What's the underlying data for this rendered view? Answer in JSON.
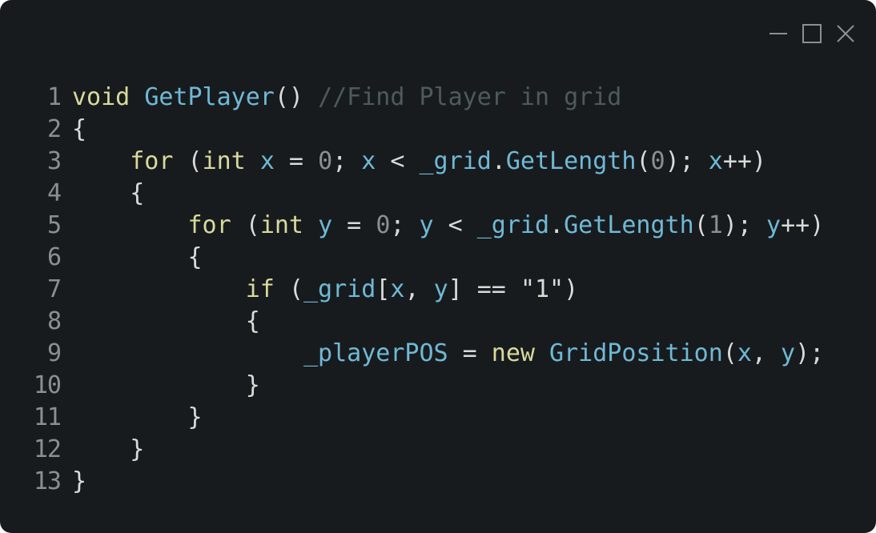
{
  "window": {
    "controls": [
      {
        "name": "minimize-icon"
      },
      {
        "name": "maximize-icon"
      },
      {
        "name": "close-icon"
      }
    ]
  },
  "colors": {
    "background": "#181b1e",
    "keyword": "#d9da9b",
    "identifier": "#6fb9d6",
    "plain": "#d8dcd9",
    "number": "#8a8f92",
    "comment": "#4d5a5e",
    "line_number": "#8a8f92"
  },
  "code": {
    "lines": [
      {
        "n": "1",
        "tokens": [
          {
            "t": "void",
            "c": "kw"
          },
          {
            "t": " ",
            "c": "pn"
          },
          {
            "t": "GetPlayer",
            "c": "fn"
          },
          {
            "t": "() ",
            "c": "pn"
          },
          {
            "t": "//Find Player in grid",
            "c": "cm"
          }
        ]
      },
      {
        "n": "2",
        "tokens": [
          {
            "t": "{",
            "c": "pn"
          }
        ]
      },
      {
        "n": "3",
        "tokens": [
          {
            "t": "    ",
            "c": "pn"
          },
          {
            "t": "for",
            "c": "kw"
          },
          {
            "t": " (",
            "c": "pn"
          },
          {
            "t": "int",
            "c": "kw"
          },
          {
            "t": " ",
            "c": "pn"
          },
          {
            "t": "x",
            "c": "id"
          },
          {
            "t": " = ",
            "c": "pn"
          },
          {
            "t": "0",
            "c": "num"
          },
          {
            "t": "; ",
            "c": "pn"
          },
          {
            "t": "x",
            "c": "id"
          },
          {
            "t": " < ",
            "c": "pn"
          },
          {
            "t": "_grid",
            "c": "id"
          },
          {
            "t": ".",
            "c": "pn"
          },
          {
            "t": "GetLength",
            "c": "fn"
          },
          {
            "t": "(",
            "c": "pn"
          },
          {
            "t": "0",
            "c": "num"
          },
          {
            "t": "); ",
            "c": "pn"
          },
          {
            "t": "x",
            "c": "id"
          },
          {
            "t": "++",
            "c": "pn"
          },
          {
            "t": ")",
            "c": "pn"
          }
        ]
      },
      {
        "n": "4",
        "tokens": [
          {
            "t": "    {",
            "c": "pn"
          }
        ]
      },
      {
        "n": "5",
        "tokens": [
          {
            "t": "        ",
            "c": "pn"
          },
          {
            "t": "for",
            "c": "kw"
          },
          {
            "t": " (",
            "c": "pn"
          },
          {
            "t": "int",
            "c": "kw"
          },
          {
            "t": " ",
            "c": "pn"
          },
          {
            "t": "y",
            "c": "id"
          },
          {
            "t": " = ",
            "c": "pn"
          },
          {
            "t": "0",
            "c": "num"
          },
          {
            "t": "; ",
            "c": "pn"
          },
          {
            "t": "y",
            "c": "id"
          },
          {
            "t": " < ",
            "c": "pn"
          },
          {
            "t": "_grid",
            "c": "id"
          },
          {
            "t": ".",
            "c": "pn"
          },
          {
            "t": "GetLength",
            "c": "fn"
          },
          {
            "t": "(",
            "c": "pn"
          },
          {
            "t": "1",
            "c": "num"
          },
          {
            "t": "); ",
            "c": "pn"
          },
          {
            "t": "y",
            "c": "id"
          },
          {
            "t": "++",
            "c": "pn"
          },
          {
            "t": ")",
            "c": "pn"
          }
        ]
      },
      {
        "n": "6",
        "tokens": [
          {
            "t": "        {",
            "c": "pn"
          }
        ]
      },
      {
        "n": "7",
        "tokens": [
          {
            "t": "            ",
            "c": "pn"
          },
          {
            "t": "if",
            "c": "kw"
          },
          {
            "t": " (",
            "c": "pn"
          },
          {
            "t": "_grid",
            "c": "id"
          },
          {
            "t": "[",
            "c": "pn"
          },
          {
            "t": "x",
            "c": "id"
          },
          {
            "t": ", ",
            "c": "pn"
          },
          {
            "t": "y",
            "c": "id"
          },
          {
            "t": "] == ",
            "c": "pn"
          },
          {
            "t": "\"1\"",
            "c": "str"
          },
          {
            "t": ")",
            "c": "pn"
          }
        ]
      },
      {
        "n": "8",
        "tokens": [
          {
            "t": "            {",
            "c": "pn"
          }
        ]
      },
      {
        "n": "9",
        "tokens": [
          {
            "t": "                ",
            "c": "pn"
          },
          {
            "t": "_playerPOS",
            "c": "id"
          },
          {
            "t": " = ",
            "c": "pn"
          },
          {
            "t": "new",
            "c": "kw"
          },
          {
            "t": " ",
            "c": "pn"
          },
          {
            "t": "GridPosition",
            "c": "fn"
          },
          {
            "t": "(",
            "c": "pn"
          },
          {
            "t": "x",
            "c": "id"
          },
          {
            "t": ", ",
            "c": "pn"
          },
          {
            "t": "y",
            "c": "id"
          },
          {
            "t": ");",
            "c": "pn"
          }
        ]
      },
      {
        "n": "10",
        "tokens": [
          {
            "t": "            }",
            "c": "pn"
          }
        ]
      },
      {
        "n": "11",
        "tokens": [
          {
            "t": "        }",
            "c": "pn"
          }
        ]
      },
      {
        "n": "12",
        "tokens": [
          {
            "t": "    }",
            "c": "pn"
          }
        ]
      },
      {
        "n": "13",
        "tokens": [
          {
            "t": "}",
            "c": "pn"
          }
        ]
      }
    ]
  }
}
